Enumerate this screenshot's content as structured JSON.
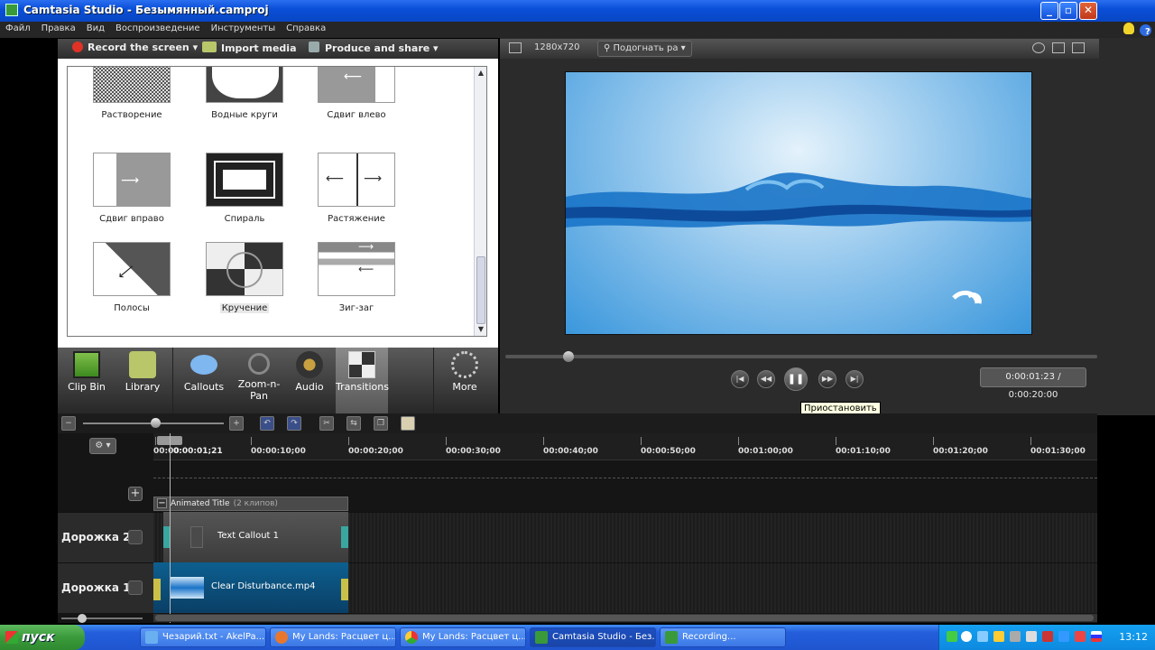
{
  "window": {
    "title": "Camtasia Studio - Безымянный.camproj",
    "minimize": "_",
    "maximize": "▫",
    "close": "✕"
  },
  "menu": [
    "Файл",
    "Правка",
    "Вид",
    "Воспроизведение",
    "Инструменты",
    "Справка"
  ],
  "toolbar": {
    "record": "Record the screen ▾",
    "import": "Import media",
    "produce": "Produce and share ▾"
  },
  "preview": {
    "resolution": "1280x720",
    "fit": "Подогнать ра ▾",
    "time": "0:00:01:23 / 0:00:20:00",
    "tooltip": "Приостановить",
    "pause_glyph": "❚❚"
  },
  "transitions": [
    {
      "label": "Растворение",
      "icon": "dissolve-icon"
    },
    {
      "label": "Водные круги",
      "icon": "ripple-icon"
    },
    {
      "label": "Сдвиг влево",
      "icon": "slide-left-icon"
    },
    {
      "label": "Сдвиг вправо",
      "icon": "slide-right-icon"
    },
    {
      "label": "Спираль",
      "icon": "spiral-icon"
    },
    {
      "label": "Растяжение",
      "icon": "stretch-icon"
    },
    {
      "label": "Полосы",
      "icon": "stripes-icon"
    },
    {
      "label": "Кручение",
      "icon": "twirl-icon"
    },
    {
      "label": "Зиг-заг",
      "icon": "zigzag-icon"
    }
  ],
  "tabs": [
    {
      "label": "Clip Bin",
      "icon": "film-icon"
    },
    {
      "label": "Library",
      "icon": "library-icon"
    },
    {
      "label": "Callouts",
      "icon": "callout-icon"
    },
    {
      "label": "Zoom-n-Pan",
      "icon": "zoom-icon"
    },
    {
      "label": "Audio",
      "icon": "speaker-icon"
    },
    {
      "label": "Transitions",
      "icon": "transitions-icon"
    },
    {
      "label": "More",
      "icon": "more-icon"
    }
  ],
  "timeline": {
    "playhead": "0:00:01;21",
    "ticks": [
      "00:00",
      "00:00:10;00",
      "00:00:20;00",
      "00:00:30;00",
      "00:00:40;00",
      "00:00:50;00",
      "00:01:00;00",
      "00:01:10;00",
      "00:01:20;00",
      "00:01:30;00"
    ],
    "group_title": "Animated Title",
    "group_count": "(2 клипов)",
    "tracks": [
      {
        "name": "Дорожка 2",
        "clip": "Text Callout 1"
      },
      {
        "name": "Дорожка 1",
        "clip": "Clear Disturbance.mp4"
      }
    ]
  },
  "taskbar": {
    "start": "пуск",
    "tasks": [
      "Чезарий.txt - AkelPa...",
      "My Lands: Расцвет ц...",
      "My Lands: Расцвет ц...",
      "Camtasia Studio - Без...",
      "Recording..."
    ],
    "clock": "13:12"
  },
  "colors": {
    "accent": "#245edb",
    "record": "#e03226",
    "track_clip_teal": "#3aa6a0",
    "track_clip_blue": "#0d5f8f"
  }
}
